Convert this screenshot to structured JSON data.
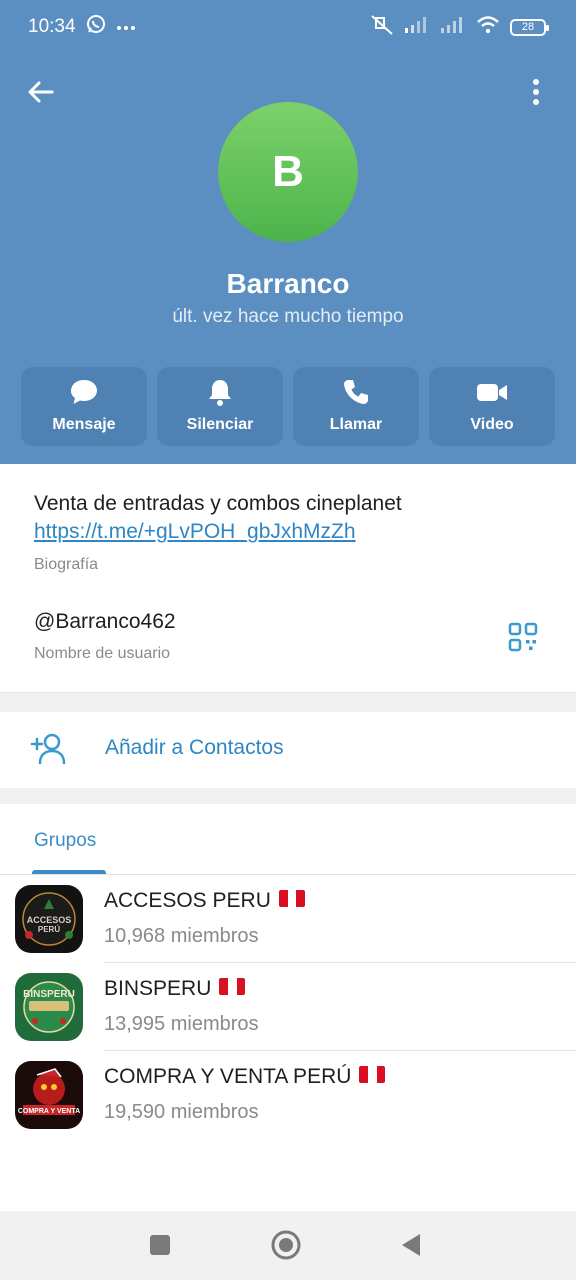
{
  "status_bar": {
    "time": "10:34",
    "battery": "28",
    "icons": [
      "whatsapp-icon",
      "more-dots-icon",
      "mute-icon",
      "signal-icon",
      "signal-icon",
      "wifi-icon",
      "battery-icon"
    ]
  },
  "header": {
    "avatar_letter": "B",
    "name": "Barranco",
    "status": "últ. vez hace mucho tiempo",
    "colors": {
      "header_bg": "#5b8fc1",
      "button_bg": "#4f81b2",
      "avatar": "#5dc158"
    }
  },
  "actions": [
    {
      "label": "Mensaje",
      "icon": "chat-bubble-icon"
    },
    {
      "label": "Silenciar",
      "icon": "bell-icon"
    },
    {
      "label": "Llamar",
      "icon": "phone-icon"
    },
    {
      "label": "Video",
      "icon": "video-camera-icon"
    }
  ],
  "info": {
    "bio_text": "Venta de entradas y combos cineplanet",
    "bio_link": "https://t.me/+gLvPOH_gbJxhMzZh",
    "bio_label": "Biografía",
    "username": "@Barranco462",
    "username_label": "Nombre de usuario"
  },
  "add_contact": {
    "label": "Añadir a Contactos"
  },
  "tabs": {
    "groups": "Grupos"
  },
  "groups": [
    {
      "name": "ACCESOS PERU",
      "members": "10,968 miembros"
    },
    {
      "name": "BINSPERU",
      "members": "13,995 miembros"
    },
    {
      "name": "COMPRA Y VENTA PERÚ",
      "members": "19,590 miembros"
    }
  ],
  "accent_color": "#2f86c4"
}
